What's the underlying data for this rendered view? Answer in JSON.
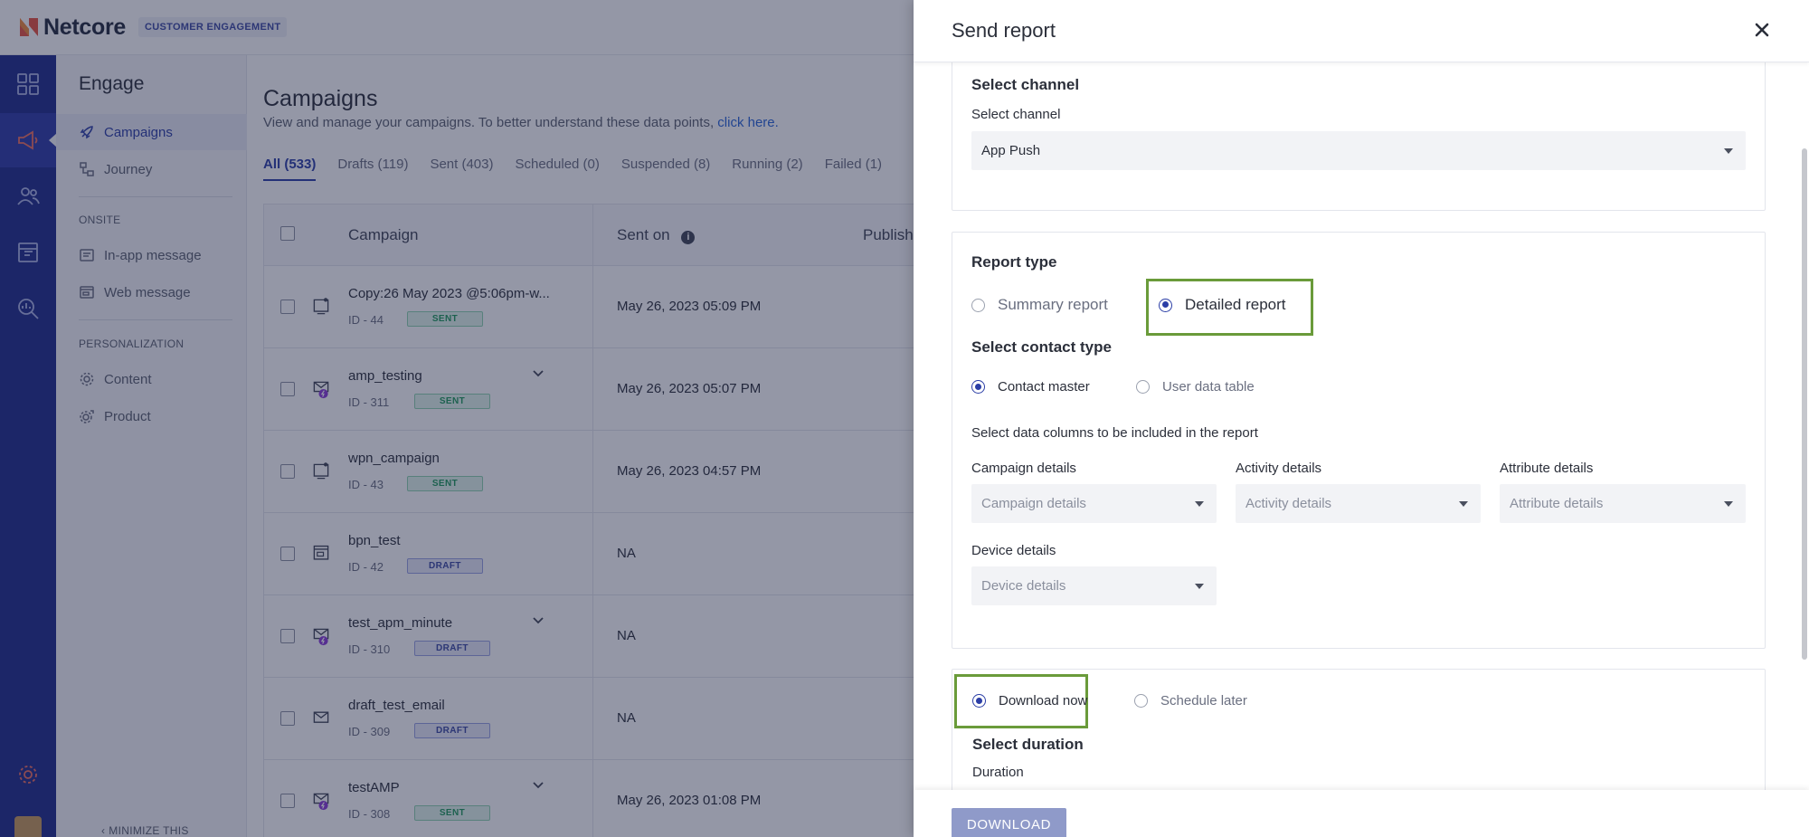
{
  "app": {
    "brand": "Netcore",
    "product_badge": "CUSTOMER ENGAGEMENT"
  },
  "rail": {
    "icons": [
      "dashboard-icon",
      "megaphone-icon",
      "users-icon",
      "layout-icon",
      "analytics-icon",
      "settings-icon",
      "profile-avatar"
    ]
  },
  "subnav": {
    "title": "Engage",
    "items": [
      {
        "label": "Campaigns",
        "icon": "rocket-icon"
      },
      {
        "label": "Journey",
        "icon": "journey-icon"
      }
    ],
    "onsite_title": "ONSITE",
    "onsite_items": [
      {
        "label": "In-app message",
        "icon": "inapp-icon"
      },
      {
        "label": "Web message",
        "icon": "web-message-icon"
      }
    ],
    "personalization_title": "PERSONALIZATION",
    "personalization_items": [
      {
        "label": "Content",
        "icon": "content-gear-icon"
      },
      {
        "label": "Product",
        "icon": "product-gear-icon"
      }
    ],
    "minimize_label": "MINIMIZE THIS"
  },
  "main": {
    "title": "Campaigns",
    "subtitle": "View and manage your campaigns. To better understand these data points, ",
    "subtitle_link": "click here.",
    "tabs": [
      {
        "label": "All (533)"
      },
      {
        "label": "Drafts (119)"
      },
      {
        "label": "Sent (403)"
      },
      {
        "label": "Scheduled (0)"
      },
      {
        "label": "Suspended (8)"
      },
      {
        "label": "Running (2)"
      },
      {
        "label": "Failed (1)"
      }
    ],
    "table": {
      "headers": {
        "campaign": "Campaign",
        "sent_on": "Sent on",
        "publish": "Publish"
      },
      "rows": [
        {
          "name": "Copy:26 May 2023 @5:06pm-w...",
          "id": "ID - 44",
          "status": "SENT",
          "sent_on": "May 26, 2023 05:09 PM",
          "icon": "app-push-icon"
        },
        {
          "name": "amp_testing",
          "id": "ID - 311",
          "status": "SENT",
          "sent_on": "May 26, 2023 05:07 PM",
          "icon": "email-amp-icon"
        },
        {
          "name": "wpn_campaign",
          "id": "ID - 43",
          "status": "SENT",
          "sent_on": "May 26, 2023 04:57 PM",
          "icon": "web-push-icon"
        },
        {
          "name": "bpn_test",
          "id": "ID - 42",
          "status": "DRAFT",
          "sent_on": "NA",
          "icon": "browser-push-icon"
        },
        {
          "name": "test_apm_minute",
          "id": "ID - 310",
          "status": "DRAFT",
          "sent_on": "NA",
          "icon": "email-amp-icon"
        },
        {
          "name": "draft_test_email",
          "id": "ID - 309",
          "status": "DRAFT",
          "sent_on": "NA",
          "icon": "email-icon"
        },
        {
          "name": "testAMP",
          "id": "ID - 308",
          "status": "SENT",
          "sent_on": "May 26, 2023 01:08 PM",
          "icon": "email-amp-icon"
        }
      ]
    }
  },
  "drawer": {
    "title": "Send report",
    "channel": {
      "section_title": "Select channel",
      "label": "Select channel",
      "value": "App Push"
    },
    "report_type": {
      "section_title": "Report type",
      "options": [
        {
          "label": "Summary report",
          "checked": false
        },
        {
          "label": "Detailed report",
          "checked": true
        }
      ]
    },
    "contact_type": {
      "section_title": "Select contact type",
      "options": [
        {
          "label": "Contact master",
          "checked": true
        },
        {
          "label": "User data table",
          "checked": false
        }
      ]
    },
    "columns_hint": "Select data columns to be included in the report",
    "columns": [
      {
        "label": "Campaign details",
        "placeholder": "Campaign details"
      },
      {
        "label": "Activity details",
        "placeholder": "Activity details"
      },
      {
        "label": "Attribute details",
        "placeholder": "Attribute details"
      },
      {
        "label": "Device details",
        "placeholder": "Device details"
      }
    ],
    "delivery": {
      "options": [
        {
          "label": "Download now",
          "checked": true
        },
        {
          "label": "Schedule later",
          "checked": false
        }
      ],
      "duration_title": "Select duration",
      "duration_label": "Duration"
    },
    "download_label": "DOWNLOAD"
  },
  "colors": {
    "primary": "#2b3ea6",
    "rail": "#1d2a8a",
    "highlight": "#6a9b3a",
    "download_button": "#8f9ac9"
  }
}
